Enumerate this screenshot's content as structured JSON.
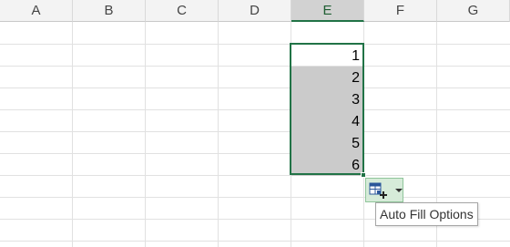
{
  "columns": [
    "A",
    "B",
    "C",
    "D",
    "E",
    "F",
    "G"
  ],
  "active_column": "E",
  "cells": {
    "E1": "1",
    "E2": "2",
    "E3": "3",
    "E4": "4",
    "E5": "5",
    "E6": "6"
  },
  "selection": {
    "range": "E1:E6"
  },
  "auto_fill": {
    "icon": "auto-fill-options-icon",
    "tooltip": "Auto Fill Options"
  },
  "colors": {
    "accent": "#217346",
    "selection_fill": "#cbcbcb",
    "button_fill": "#d6ebd9"
  }
}
